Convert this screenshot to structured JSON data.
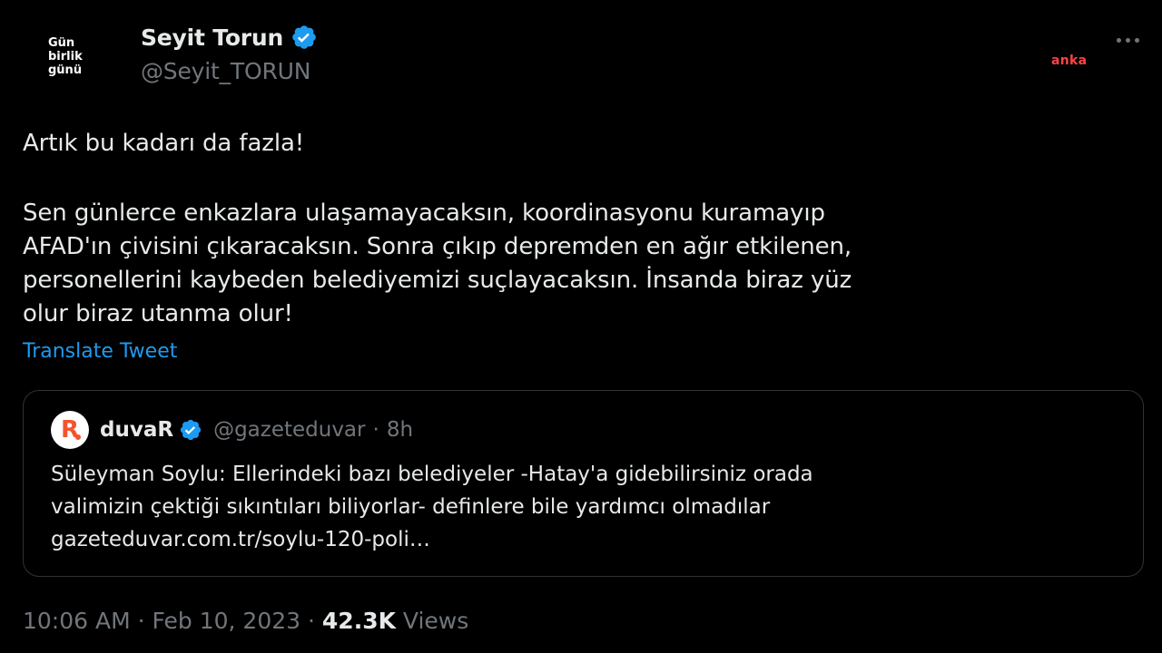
{
  "author": {
    "avatar_lines": [
      "Gün",
      "birlik",
      "günü"
    ],
    "name": "Seyit Torun",
    "handle": "@Seyit_TORUN",
    "verified_icon": "verified-badge-icon"
  },
  "watermark": "anka",
  "tweet": {
    "first_line": "Artık bu kadarı da fazla!",
    "body_lines": [
      "Sen günlerce enkazlara ulaşamayacaksın, koordinasyonu kuramayıp",
      "AFAD'ın çivisini çıkaracaksın. Sonra çıkıp depremden en ağır etkilenen,",
      "personellerini kaybeden belediyemizi suçlayacaksın. İnsanda biraz yüz",
      "olur biraz utanma olur!"
    ],
    "translate_label": "Translate Tweet"
  },
  "quote": {
    "avatar_letter": "R",
    "name": "duvaR",
    "handle": "@gazeteduvar",
    "separator": "·",
    "time": "8h",
    "text_lines": [
      "Süleyman Soylu: Ellerindeki bazı belediyeler -Hatay'a gidebilirsiniz orada",
      "valimizin çektiği sıkıntıları biliyorlar- definlere bile yardımcı olmadılar",
      "gazeteduvar.com.tr/soylu-120-poli…"
    ]
  },
  "meta": {
    "time": "10:06 AM",
    "sep1": " · ",
    "date": "Feb 10, 2023",
    "sep2": " · ",
    "views_count": "42.3K",
    "views_label": " Views"
  },
  "colors": {
    "background": "#000000",
    "text": "#e7e9ea",
    "secondary": "#71767b",
    "link": "#1d9bf0",
    "verified": "#1d9bf0",
    "watermark": "#ff4444",
    "border": "#2f3336"
  }
}
